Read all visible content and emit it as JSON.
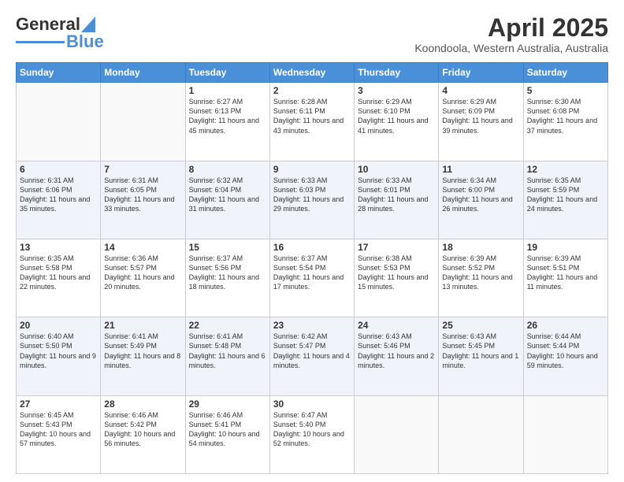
{
  "header": {
    "logo_general": "General",
    "logo_blue": "Blue",
    "title": "April 2025",
    "subtitle": "Koondoola, Western Australia, Australia"
  },
  "weekdays": [
    "Sunday",
    "Monday",
    "Tuesday",
    "Wednesday",
    "Thursday",
    "Friday",
    "Saturday"
  ],
  "weeks": [
    [
      {
        "day": "",
        "sunrise": "",
        "sunset": "",
        "daylight": ""
      },
      {
        "day": "",
        "sunrise": "",
        "sunset": "",
        "daylight": ""
      },
      {
        "day": "1",
        "sunrise": "Sunrise: 6:27 AM",
        "sunset": "Sunset: 6:13 PM",
        "daylight": "Daylight: 11 hours and 45 minutes."
      },
      {
        "day": "2",
        "sunrise": "Sunrise: 6:28 AM",
        "sunset": "Sunset: 6:11 PM",
        "daylight": "Daylight: 11 hours and 43 minutes."
      },
      {
        "day": "3",
        "sunrise": "Sunrise: 6:29 AM",
        "sunset": "Sunset: 6:10 PM",
        "daylight": "Daylight: 11 hours and 41 minutes."
      },
      {
        "day": "4",
        "sunrise": "Sunrise: 6:29 AM",
        "sunset": "Sunset: 6:09 PM",
        "daylight": "Daylight: 11 hours and 39 minutes."
      },
      {
        "day": "5",
        "sunrise": "Sunrise: 6:30 AM",
        "sunset": "Sunset: 6:08 PM",
        "daylight": "Daylight: 11 hours and 37 minutes."
      }
    ],
    [
      {
        "day": "6",
        "sunrise": "Sunrise: 6:31 AM",
        "sunset": "Sunset: 6:06 PM",
        "daylight": "Daylight: 11 hours and 35 minutes."
      },
      {
        "day": "7",
        "sunrise": "Sunrise: 6:31 AM",
        "sunset": "Sunset: 6:05 PM",
        "daylight": "Daylight: 11 hours and 33 minutes."
      },
      {
        "day": "8",
        "sunrise": "Sunrise: 6:32 AM",
        "sunset": "Sunset: 6:04 PM",
        "daylight": "Daylight: 11 hours and 31 minutes."
      },
      {
        "day": "9",
        "sunrise": "Sunrise: 6:33 AM",
        "sunset": "Sunset: 6:03 PM",
        "daylight": "Daylight: 11 hours and 29 minutes."
      },
      {
        "day": "10",
        "sunrise": "Sunrise: 6:33 AM",
        "sunset": "Sunset: 6:01 PM",
        "daylight": "Daylight: 11 hours and 28 minutes."
      },
      {
        "day": "11",
        "sunrise": "Sunrise: 6:34 AM",
        "sunset": "Sunset: 6:00 PM",
        "daylight": "Daylight: 11 hours and 26 minutes."
      },
      {
        "day": "12",
        "sunrise": "Sunrise: 6:35 AM",
        "sunset": "Sunset: 5:59 PM",
        "daylight": "Daylight: 11 hours and 24 minutes."
      }
    ],
    [
      {
        "day": "13",
        "sunrise": "Sunrise: 6:35 AM",
        "sunset": "Sunset: 5:58 PM",
        "daylight": "Daylight: 11 hours and 22 minutes."
      },
      {
        "day": "14",
        "sunrise": "Sunrise: 6:36 AM",
        "sunset": "Sunset: 5:57 PM",
        "daylight": "Daylight: 11 hours and 20 minutes."
      },
      {
        "day": "15",
        "sunrise": "Sunrise: 6:37 AM",
        "sunset": "Sunset: 5:56 PM",
        "daylight": "Daylight: 11 hours and 18 minutes."
      },
      {
        "day": "16",
        "sunrise": "Sunrise: 6:37 AM",
        "sunset": "Sunset: 5:54 PM",
        "daylight": "Daylight: 11 hours and 17 minutes."
      },
      {
        "day": "17",
        "sunrise": "Sunrise: 6:38 AM",
        "sunset": "Sunset: 5:53 PM",
        "daylight": "Daylight: 11 hours and 15 minutes."
      },
      {
        "day": "18",
        "sunrise": "Sunrise: 6:39 AM",
        "sunset": "Sunset: 5:52 PM",
        "daylight": "Daylight: 11 hours and 13 minutes."
      },
      {
        "day": "19",
        "sunrise": "Sunrise: 6:39 AM",
        "sunset": "Sunset: 5:51 PM",
        "daylight": "Daylight: 11 hours and 11 minutes."
      }
    ],
    [
      {
        "day": "20",
        "sunrise": "Sunrise: 6:40 AM",
        "sunset": "Sunset: 5:50 PM",
        "daylight": "Daylight: 11 hours and 9 minutes."
      },
      {
        "day": "21",
        "sunrise": "Sunrise: 6:41 AM",
        "sunset": "Sunset: 5:49 PM",
        "daylight": "Daylight: 11 hours and 8 minutes."
      },
      {
        "day": "22",
        "sunrise": "Sunrise: 6:41 AM",
        "sunset": "Sunset: 5:48 PM",
        "daylight": "Daylight: 11 hours and 6 minutes."
      },
      {
        "day": "23",
        "sunrise": "Sunrise: 6:42 AM",
        "sunset": "Sunset: 5:47 PM",
        "daylight": "Daylight: 11 hours and 4 minutes."
      },
      {
        "day": "24",
        "sunrise": "Sunrise: 6:43 AM",
        "sunset": "Sunset: 5:46 PM",
        "daylight": "Daylight: 11 hours and 2 minutes."
      },
      {
        "day": "25",
        "sunrise": "Sunrise: 6:43 AM",
        "sunset": "Sunset: 5:45 PM",
        "daylight": "Daylight: 11 hours and 1 minute."
      },
      {
        "day": "26",
        "sunrise": "Sunrise: 6:44 AM",
        "sunset": "Sunset: 5:44 PM",
        "daylight": "Daylight: 10 hours and 59 minutes."
      }
    ],
    [
      {
        "day": "27",
        "sunrise": "Sunrise: 6:45 AM",
        "sunset": "Sunset: 5:43 PM",
        "daylight": "Daylight: 10 hours and 57 minutes."
      },
      {
        "day": "28",
        "sunrise": "Sunrise: 6:46 AM",
        "sunset": "Sunset: 5:42 PM",
        "daylight": "Daylight: 10 hours and 56 minutes."
      },
      {
        "day": "29",
        "sunrise": "Sunrise: 6:46 AM",
        "sunset": "Sunset: 5:41 PM",
        "daylight": "Daylight: 10 hours and 54 minutes."
      },
      {
        "day": "30",
        "sunrise": "Sunrise: 6:47 AM",
        "sunset": "Sunset: 5:40 PM",
        "daylight": "Daylight: 10 hours and 52 minutes."
      },
      {
        "day": "",
        "sunrise": "",
        "sunset": "",
        "daylight": ""
      },
      {
        "day": "",
        "sunrise": "",
        "sunset": "",
        "daylight": ""
      },
      {
        "day": "",
        "sunrise": "",
        "sunset": "",
        "daylight": ""
      }
    ]
  ]
}
